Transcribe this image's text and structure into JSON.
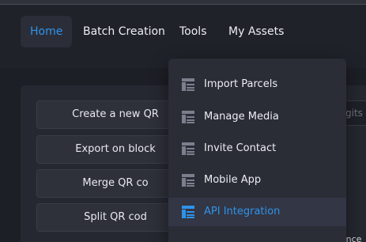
{
  "nav": {
    "items": [
      {
        "label": "Home"
      },
      {
        "label": "Batch Creation"
      },
      {
        "label": "Tools"
      },
      {
        "label": "My Assets"
      }
    ]
  },
  "actions": [
    {
      "label": "Create a new QR"
    },
    {
      "label": "Export on block"
    },
    {
      "label": "Merge QR co"
    },
    {
      "label": "Split QR cod"
    }
  ],
  "background": {
    "field_hint": "gits t",
    "footer_note": "Parcel Reference"
  },
  "dropdown": {
    "items": [
      {
        "label": "Import Parcels",
        "icon": "layout-icon"
      },
      {
        "label": "Manage Media",
        "icon": "layout-icon"
      },
      {
        "label": "Invite Contact",
        "icon": "layout-icon"
      },
      {
        "label": "Mobile App",
        "icon": "layout-icon"
      },
      {
        "label": "API Integration",
        "icon": "layout-icon"
      }
    ],
    "selected_index": 4
  },
  "colors": {
    "accent": "#2f93ea",
    "icon_muted": "#7c7f8c",
    "background": "#1d1f26",
    "menu_bg": "#2a2c36"
  }
}
